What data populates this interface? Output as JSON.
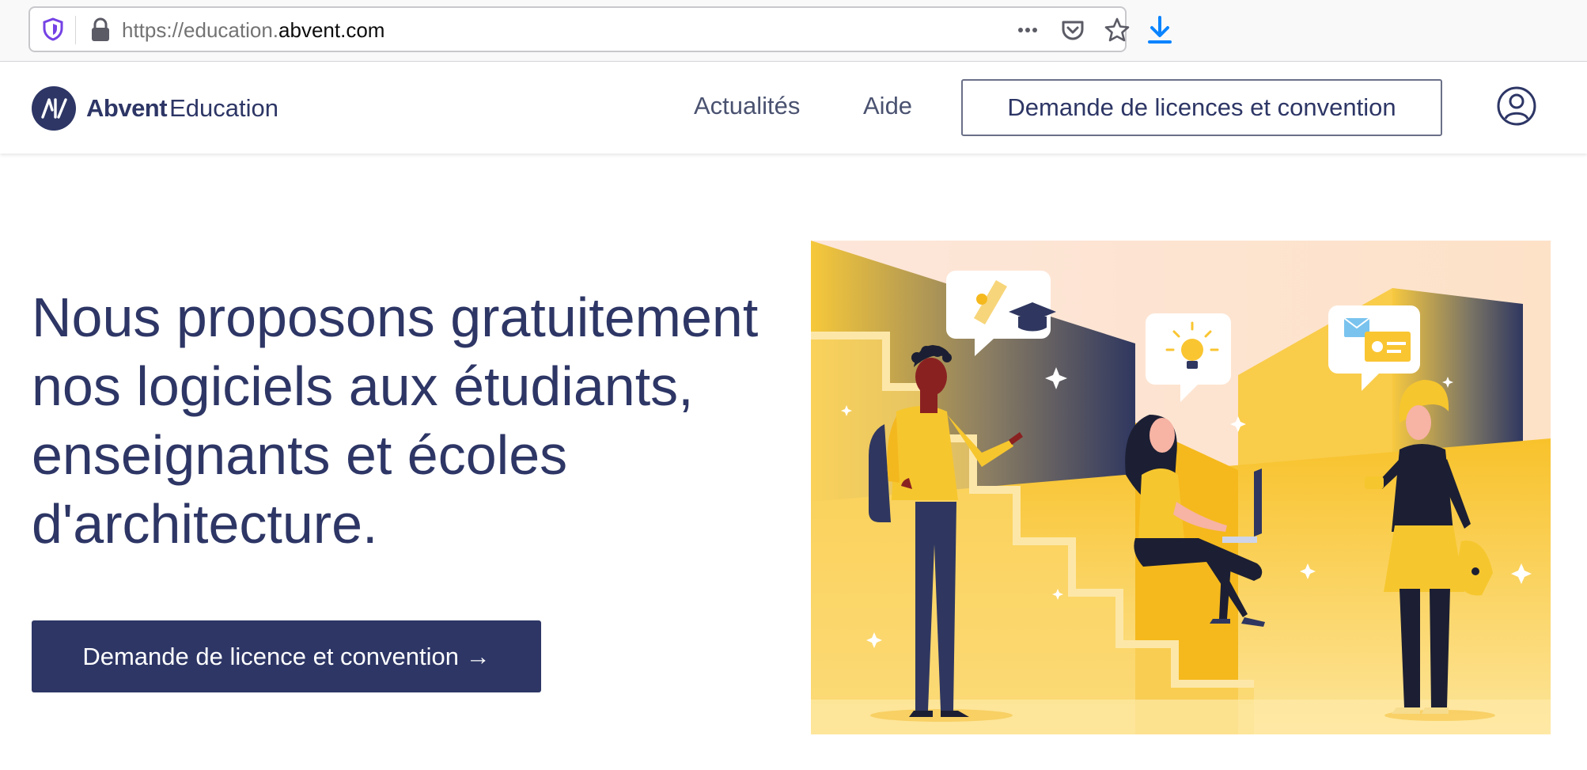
{
  "browser": {
    "url_prefix": "https://education.",
    "url_domain": "abvent.com",
    "icons": [
      "shield-icon",
      "lock-icon",
      "more-icon",
      "pocket-icon",
      "bookmark-star-icon",
      "download-icon"
    ]
  },
  "header": {
    "logo_bold": "Abvent",
    "logo_light": "Education",
    "nav": [
      "Actualités",
      "Aide"
    ],
    "cta_label": "Demande de licences et convention"
  },
  "hero": {
    "title": "Nous proposons gratuitement nos logiciels aux étudiants, enseignants et écoles d'architecture.",
    "cta_label": "Demande de licence et convention →"
  },
  "colors": {
    "brand_navy": "#2d3665",
    "illustration_yellow": "#f7bf23"
  }
}
